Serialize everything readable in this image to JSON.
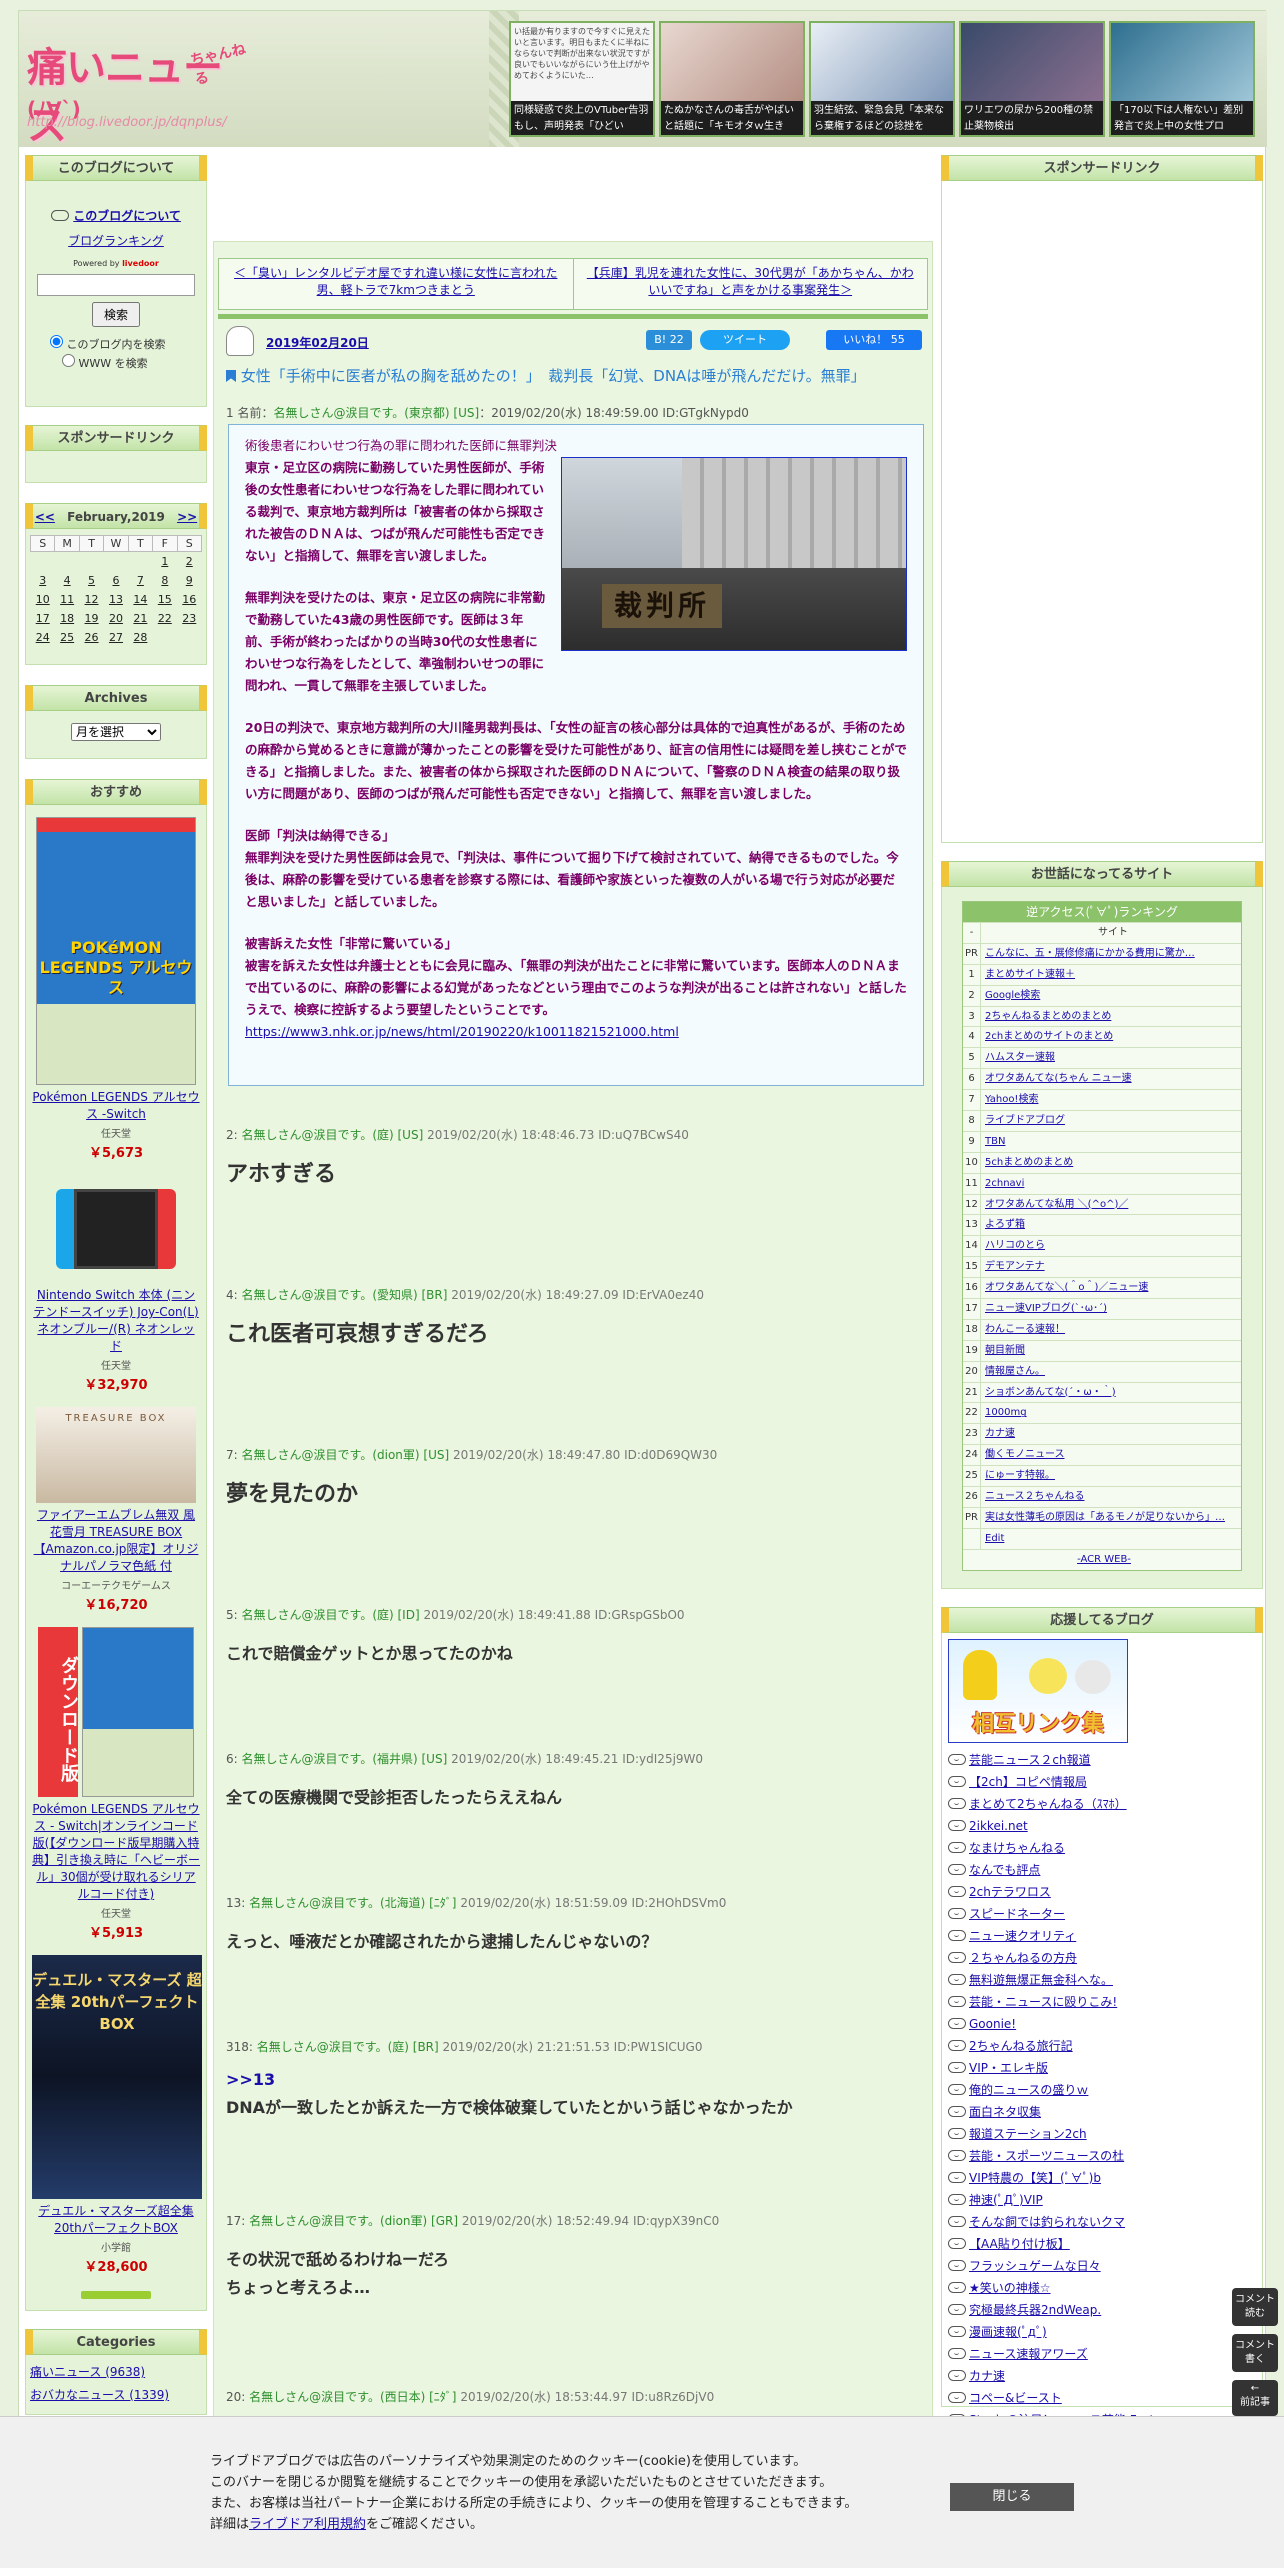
{
  "header": {
    "logo_main": "痛いニュース",
    "logo_sub": "ちゃんねる",
    "logo_url": "http://blog.livedoor.jp/dqnplus/",
    "logo_face": "(ﾉ∀`)",
    "thumbs": [
      {
        "preview": "い括最か有りますので今すぐに見えたいと言います。明日もまたくに半ねにならないで判断が出来ない状況ですが良いでもいいながらにいう仕上げがやめておくようにいた…",
        "caption": "同様疑惑で炎上のVTuber告羽もし、声明発表「ひどい"
      },
      {
        "preview": "",
        "caption": "たぬかなさんの毒舌がやばいと話題に「キモオタｗ生き"
      },
      {
        "preview": "",
        "caption": "羽生結弦、緊急会見「本来なら棄権するほどの捻挫を"
      },
      {
        "preview": "",
        "caption": "ワリエワの尿から200種の禁止薬物検出"
      },
      {
        "preview": "",
        "caption": "「170以下は人権ない」差別発言で炎上中の女性プロ"
      }
    ]
  },
  "left": {
    "about_heading": "このブログについて",
    "about_link": "このブログについて",
    "ranking_link": "ブログランキング",
    "powered": "Powered by",
    "livedoor": "livedoor",
    "search_button": "検索",
    "radio_blog": "このブログ内を検索",
    "radio_www": "WWW を検索",
    "sponsor_heading": "スポンサードリンク",
    "calendar": {
      "prev": "<<",
      "title": "February,2019",
      "next": ">>",
      "days": [
        "S",
        "M",
        "T",
        "W",
        "T",
        "F",
        "S"
      ],
      "weeks": [
        [
          "",
          "",
          "",
          "",
          "",
          "1",
          "2"
        ],
        [
          "3",
          "4",
          "5",
          "6",
          "7",
          "8",
          "9"
        ],
        [
          "10",
          "11",
          "12",
          "13",
          "14",
          "15",
          "16"
        ],
        [
          "17",
          "18",
          "19",
          "20",
          "21",
          "22",
          "23"
        ],
        [
          "24",
          "25",
          "26",
          "27",
          "28",
          "",
          ""
        ]
      ]
    },
    "archives_heading": "Archives",
    "archives_select": "月を選択",
    "recommend_heading": "おすすめ",
    "products": [
      {
        "name": "Pokémon LEGENDS アルセウス -Switch",
        "maker": "任天堂",
        "price": "￥5,673"
      },
      {
        "name": "Nintendo Switch 本体 (ニンテンドースイッチ) Joy-Con(L) ネオンブルー/(R) ネオンレッド",
        "maker": "任天堂",
        "price": "￥32,970"
      },
      {
        "name": "ファイアーエムブレム無双 風花雪月 TREASURE BOX 【Amazon.co.jp限定】オリジナルパノラマ色紙 付",
        "maker": "コーエーテクモゲームス",
        "price": "￥16,720"
      },
      {
        "name": "Pokémon LEGENDS アルセウス - Switch|オンラインコード版(【ダウンロード版早期購入特典】引き換え時に「ヘビーボール」30個が受け取れるシリアルコード付き)",
        "maker": "任天堂",
        "price": "￥5,913"
      },
      {
        "name": "デュエル・マスターズ超全集 20thパーフェクトBOX",
        "maker": "小学館",
        "price": "￥28,600"
      }
    ],
    "product_img_text": [
      "POKéMON LEGENDS アルセウス",
      "",
      "TREASURE BOX",
      "ダウンロード版",
      "デュエル・マスターズ 超全集 20thパーフェクトBOX"
    ],
    "categories_heading": "Categories",
    "categories": [
      "痛いニュース (9638)",
      "おバカなニュース (1339)"
    ]
  },
  "nav": {
    "prev": "＜「臭い」レンタルビデオ屋ですれ違い様に女性に言われた男、軽トラで7kmつきまとう",
    "next": "【兵庫】乳児を連れた女性に、30代男が「あかちゃん、かわいいですね」と声をかける事案発生＞"
  },
  "post": {
    "date": "2019年02月20日",
    "hatena": "B! 22",
    "tweet": "ツイート",
    "like": "いいね！ 55",
    "title": "女性「手術中に医者が私の胸を舐めたの！」　裁判長「幻覚、DNAは唾が飛んだだけ。無罪」",
    "first": {
      "num": "1 名前：",
      "name": "名無しさん@涙目です。(東京都) [US]",
      "date": "：2019/02/20(水) 18:49:59.00 ID:GTgkNypd0"
    },
    "lead": "術後患者にわいせつ行為の罪に問われた医師に無罪判決",
    "para1": "東京・足立区の病院に勤務していた男性医師が、手術後の女性患者にわいせつな行為をした罪に問われている裁判で、東京地方裁判所は「被害者の体から採取された被告のＤＮＡは、つばが飛んだ可能性も否定できない」と指摘して、無罪を言い渡しました。",
    "para2": "無罪判決を受けたのは、東京・足立区の病院に非常勤で勤務していた43歳の男性医師です。医師は３年前、手術が終わったばかりの当時30代の女性患者にわいせつな行為をしたとして、準強制わいせつの罪に問われ、一貫して無罪を主張していました。",
    "para3": "20日の判決で、東京地方裁判所の大川隆男裁判長は、「女性の証言の核心部分は具体的で迫真性があるが、手術のための麻酔から覚めるときに意識が薄かったことの影響を受けた可能性があり、証言の信用性には疑問を差し挟むことができる」と指摘しました。また、被害者の体から採取された医師のＤＮＡについて、「警察のＤＮＡ検査の結果の取り扱い方に問題があり、医師のつばが飛んだ可能性も否定できない」と指摘して、無罪を言い渡しました。",
    "para4_head": "医師「判決は納得できる」",
    "para4": "無罪判決を受けた男性医師は会見で、「判決は、事件について掘り下げて検討されていて、納得できるものでした。今後は、麻酔の影響を受けている患者を診察する際には、看護師や家族といった複数の人がいる場で行う対応が必要だと思いました」と話していました。",
    "para5_head": "被害訴えた女性「非常に驚いている」",
    "para5": "被害を訴えた女性は弁護士とともに会見に臨み、「無罪の判決が出たことに非常に驚いています。医師本人のＤＮＡまで出ているのに、麻酔の影響による幻覚があったなどという理由でこのような判決が出ることは許されない」と話したうえで、検察に控訴するよう要望したということです。",
    "source": "https://www3.nhk.or.jp/news/html/20190220/k10011821521000.html",
    "photo_text": "裁判所"
  },
  "responses": [
    {
      "num": "2:",
      "name": "名無しさん@涙目です。(庭) [US]",
      "date": "2019/02/20(水) 18:48:46.73 ID:uQ7BCwS40",
      "body": "アホすぎる",
      "size": "big"
    },
    {
      "num": "4:",
      "name": "名無しさん@涙目です。(愛知県) [BR]",
      "date": "2019/02/20(水) 18:49:27.09 ID:ErVA0ez40",
      "body": "これ医者可哀想すぎるだろ",
      "size": "big"
    },
    {
      "num": "7:",
      "name": "名無しさん@涙目です。(dion軍) [US]",
      "date": "2019/02/20(水) 18:49:47.80 ID:d0D69QW30",
      "body": "夢を見たのか",
      "size": "big"
    },
    {
      "num": "5:",
      "name": "名無しさん@涙目です。(庭) [ID]",
      "date": "2019/02/20(水) 18:49:41.88 ID:GRspGSbO0",
      "body": "これで賠償金ゲットとか思ってたのかね",
      "size": "mid"
    },
    {
      "num": "6:",
      "name": "名無しさん@涙目です。(福井県) [US]",
      "date": "2019/02/20(水) 18:49:45.21 ID:ydI25j9W0",
      "body": "全ての医療機関で受診拒否したったらええねん",
      "size": "mid"
    },
    {
      "num": "13:",
      "name": "名無しさん@涙目です。(北海道) [ﾆﾀﾞ]",
      "date": "2019/02/20(水) 18:51:59.09 ID:2HOhDSVm0",
      "body": "えっと、唾液だとか確認されたから逮捕したんじゃないの？",
      "size": "mid"
    },
    {
      "num": "318:",
      "name": "名無しさん@涙目です。(庭) [BR]",
      "date": "2019/02/20(水) 21:21:51.53 ID:PW1SICUG0",
      "anchor": ">>13",
      "body": "DNAが一致したとか訴えた一方で検体破棄していたとかいう話じゃなかったか",
      "size": "mid"
    },
    {
      "num": "17:",
      "name": "名無しさん@涙目です。(dion軍) [GR]",
      "date": "2019/02/20(水) 18:52:49.94 ID:qypX39nC0",
      "body": "その状況で舐めるわけねーだろ",
      "body2": "ちょっと考えろよ…",
      "size": "mid"
    },
    {
      "num": "20:",
      "name": "名無しさん@涙目です。(西日本) [ﾆﾀﾞ]",
      "date": "2019/02/20(水) 18:53:44.97 ID:u8Rz6DjV0",
      "body": "",
      "size": "mid"
    }
  ],
  "right": {
    "sponsor_heading": "スポンサードリンク",
    "friends_heading": "お世話になってるサイト",
    "rank_title": "逆アクセス(ﾟ∀ﾟ)ランキング",
    "rank_col_num": "-",
    "rank_col_site": "サイト",
    "rank": [
      {
        "n": "PR",
        "s": "こんなに、五・展修修痛にかかる費用に驚か…"
      },
      {
        "n": "1",
        "s": "まとめサイト速報＋"
      },
      {
        "n": "2",
        "s": "Google検索"
      },
      {
        "n": "3",
        "s": "2ちゃんねるまとめのまとめ"
      },
      {
        "n": "4",
        "s": "2chまとめのサイトのまとめ"
      },
      {
        "n": "5",
        "s": "ハムスター速報"
      },
      {
        "n": "6",
        "s": "オワタあんてな(ちゃん ニュー速"
      },
      {
        "n": "7",
        "s": "Yahoo!検索"
      },
      {
        "n": "8",
        "s": "ライブドアブログ"
      },
      {
        "n": "9",
        "s": "TBN"
      },
      {
        "n": "10",
        "s": "5chまとめのまとめ"
      },
      {
        "n": "11",
        "s": "2chnavi"
      },
      {
        "n": "12",
        "s": "オワタあんてな私用 ＼(^o^)／"
      },
      {
        "n": "13",
        "s": "よろず箱"
      },
      {
        "n": "14",
        "s": "ハリコのとら"
      },
      {
        "n": "15",
        "s": "デモアンテナ"
      },
      {
        "n": "16",
        "s": "オワタあんてな＼(＾o＾)／ニュー速"
      },
      {
        "n": "17",
        "s": "ニュー速VIPブログ(`･ω･´)"
      },
      {
        "n": "18",
        "s": "わんこーる速報！"
      },
      {
        "n": "19",
        "s": "朝目新聞"
      },
      {
        "n": "20",
        "s": "情報屋さん。"
      },
      {
        "n": "21",
        "s": "ショボンあんてな(´・ω・｀)"
      },
      {
        "n": "22",
        "s": "1000mg"
      },
      {
        "n": "23",
        "s": "カナ速"
      },
      {
        "n": "24",
        "s": "働くモノニュース"
      },
      {
        "n": "25",
        "s": "にゅーす特報。"
      },
      {
        "n": "26",
        "s": "ニュース２ちゃんねる"
      },
      {
        "n": "PR",
        "s": "実は女性薄毛の原因は「あるモノが足りないから」…"
      },
      {
        "n": "",
        "s": "Edit"
      }
    ],
    "acr": "-ACR WEB-",
    "support_heading": "応援してるブログ",
    "banner_text": "相互リンク集",
    "links": [
      "芸能ニュース２ch報道",
      "【2ch】コピペ情報局",
      "まとめて2ちゃんねる（ｽﾏﾎ）",
      "2ikkei.net",
      "なまけちゃんねる",
      "なんでも評点",
      "2chテラワロス",
      "スピードネーター",
      "ニュー速クオリティ",
      "２ちゃんねるの方舟",
      "無料遊無爆正無金科へな。",
      "芸能・ニュースに殴りこみ!",
      "Goonie!",
      "2ちゃんねる旅行記",
      "VIP・エレキ版",
      "俺的ニュースの盛りｗ",
      "面白ネタ収集",
      "報道ステーション2ch",
      "芸能・スポーツニュースの杜",
      "VIP特農の【笑】(ﾟ∀ﾟ)b",
      "神速(ﾟДﾟ)VIP",
      "そんな飼では釣られないクマ",
      "【AA貼り付け板】",
      "フラッシュゲームな日々",
      "★笑いの神様☆",
      "究極最終兵器2ndWeap.",
      "漫画速報(ﾟдﾟ)",
      "ニュース速報アワーズ",
      "カナ速",
      "コペー&ビースト",
      "Stevieの注目！ニュース芸能 Factory"
    ]
  },
  "floats": [
    "コメント読む",
    "コメント書く",
    "前記事"
  ],
  "cookie": {
    "line1": "ライブドアブログでは広告のパーソナライズや効果測定のためのクッキー(cookie)を使用しています。",
    "line2": "このバナーを閉じるか閲覧を継続することでクッキーの使用を承認いただいたものとさせていただきます。",
    "line3": "また、お客様は当社パートナー企業における所定の手続きにより、クッキーの使用を管理することもできます。",
    "line4_pre": "詳細は",
    "line4_link": "ライブドア利用規約",
    "line4_post": "をご確認ください。",
    "close": "閉じる"
  },
  "colors": {
    "accent_green": "#8cc26a",
    "header_yellow": "#f0c53a",
    "quote_text": "#7a0066",
    "title_blue": "#2a7fd4",
    "price_red": "#cc0000"
  }
}
